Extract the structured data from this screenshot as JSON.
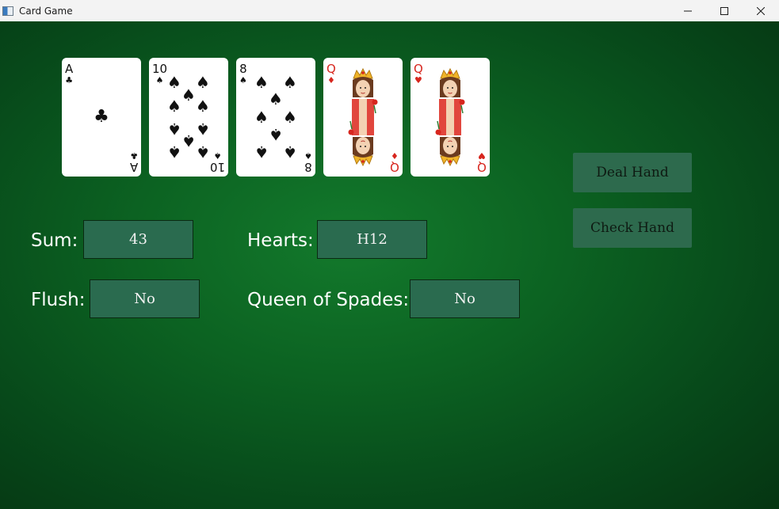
{
  "window": {
    "title": "Card Game",
    "icons": {
      "app": "app-window-icon",
      "minimize": "minimize-icon",
      "maximize": "maximize-icon",
      "close": "close-icon"
    }
  },
  "cards": [
    {
      "rank": "A",
      "suit": "♣",
      "suit_name": "clubs",
      "color": "#111111"
    },
    {
      "rank": "10",
      "suit": "♠",
      "suit_name": "spades",
      "color": "#111111"
    },
    {
      "rank": "8",
      "suit": "♠",
      "suit_name": "spades",
      "color": "#111111"
    },
    {
      "rank": "Q",
      "suit": "♦",
      "suit_name": "diamonds",
      "color": "#d7261e"
    },
    {
      "rank": "Q",
      "suit": "♥",
      "suit_name": "hearts",
      "color": "#d7261e"
    }
  ],
  "stats": {
    "sum_label": "Sum:",
    "sum_value": "43",
    "hearts_label": "Hearts:",
    "hearts_value": "H12",
    "flush_label": "Flush:",
    "flush_value": "No",
    "queen_label": "Queen of Spades:",
    "queen_value": "No"
  },
  "buttons": {
    "deal": "Deal Hand",
    "check": "Check Hand"
  },
  "colors": {
    "felt": "#0c6322",
    "field": "#2a6b4f",
    "button": "#2d6a4d"
  }
}
